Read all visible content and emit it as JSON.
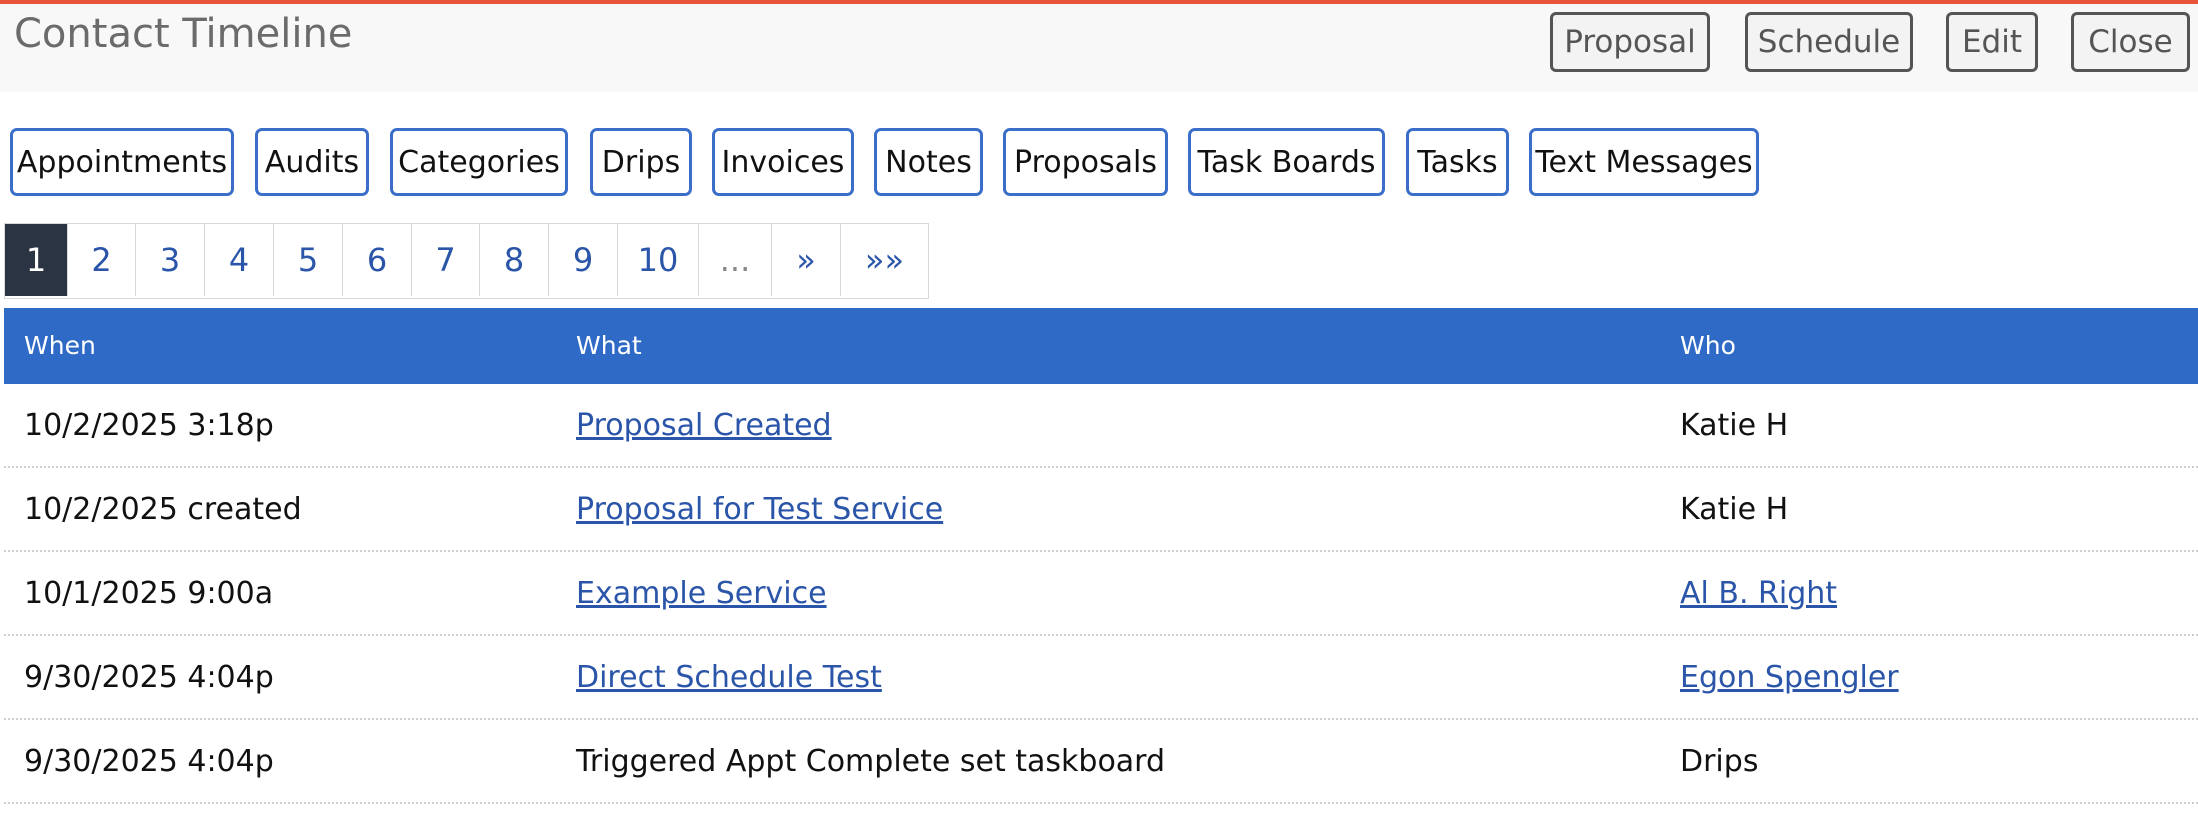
{
  "header": {
    "title": "Contact Timeline",
    "buttons": {
      "proposal": "Proposal",
      "schedule": "Schedule",
      "edit": "Edit",
      "close": "Close"
    }
  },
  "tabs": [
    "Appointments",
    "Audits",
    "Categories",
    "Drips",
    "Invoices",
    "Notes",
    "Proposals",
    "Task Boards",
    "Tasks",
    "Text Messages"
  ],
  "pagination": {
    "current": "1",
    "pages": [
      "1",
      "2",
      "3",
      "4",
      "5",
      "6",
      "7",
      "8",
      "9",
      "10",
      "...",
      "»",
      "»»"
    ]
  },
  "table": {
    "columns": [
      "When",
      "What",
      "Who"
    ],
    "rows": [
      {
        "when": "10/2/2025 3:18p",
        "what": "Proposal Created",
        "what_link": true,
        "who": "Katie H",
        "who_link": false
      },
      {
        "when": "10/2/2025 created",
        "what": "Proposal for Test Service",
        "what_link": true,
        "who": "Katie H",
        "who_link": false
      },
      {
        "when": "10/1/2025 9:00a",
        "what": "Example Service",
        "what_link": true,
        "who": "Al B. Right",
        "who_link": true
      },
      {
        "when": "9/30/2025 4:04p",
        "what": "Direct Schedule Test",
        "what_link": true,
        "who": "Egon Spengler",
        "who_link": true
      },
      {
        "when": "9/30/2025 4:04p",
        "what": "Triggered Appt Complete set taskboard",
        "what_link": false,
        "who": "Drips",
        "who_link": false
      }
    ]
  },
  "colors": {
    "accent_top": "#e8553a",
    "table_header": "#2e6ac6",
    "tab_border": "#3a6ec8",
    "link": "#2a55a8",
    "pager_active": "#2a3443"
  }
}
